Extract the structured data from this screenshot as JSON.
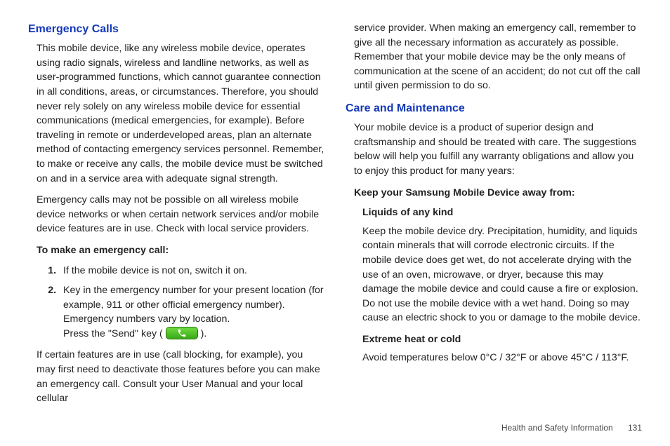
{
  "left": {
    "heading": "Emergency Calls",
    "para1": "This mobile device, like any wireless mobile device, operates using radio signals, wireless and landline networks, as well as user-programmed functions, which cannot guarantee connection in all conditions, areas, or circumstances. Therefore, you should never rely solely on any wireless mobile device for essential communications (medical emergencies, for example). Before traveling in remote or underdeveloped areas, plan an alternate method of contacting emergency services personnel. Remember, to make or receive any calls, the mobile device must be switched on and in a service area with adequate signal strength.",
    "para2": "Emergency calls may not be possible on all wireless mobile device networks or when certain network services and/or mobile device features are in use. Check with local service providers.",
    "subhead": "To make an emergency call:",
    "step1": "If the mobile device is not on, switch it on.",
    "step2a": "Key in the emergency number for your present location (for example, 911 or other official emergency number). Emergency numbers vary by location.",
    "step2b_before": "Press the \"Send\" key ( ",
    "step2b_after": " ).",
    "para3": "If certain features are in use (call blocking, for example), you may first need to deactivate those features before you can make an emergency call. Consult your User Manual and your local cellular"
  },
  "right": {
    "cont": "service provider. When making an emergency call, remember to give all the necessary information as accurately as possible. Remember that your mobile device may be the only means of communication at the scene of an accident; do not cut off the call until given permission to do so.",
    "heading": "Care and Maintenance",
    "para1": "Your mobile device is a product of superior design and craftsmanship and should be treated with care. The suggestions below will help you fulfill any warranty obligations and allow you to enjoy this product for many years:",
    "subhead": "Keep your Samsung Mobile Device away from:",
    "liquids_title": "Liquids of any kind",
    "liquids_body": "Keep the mobile device dry. Precipitation, humidity, and liquids contain minerals that will corrode electronic circuits. If the mobile device does get wet, do not accelerate drying with the use of an oven, microwave, or dryer, because this may damage the mobile device and could cause a fire or explosion. Do not use the mobile device with a wet hand. Doing so may cause an electric shock to you or damage to the mobile device.",
    "heat_title": "Extreme heat or cold",
    "heat_body": "Avoid temperatures below 0°C / 32°F or above 45°C / 113°F."
  },
  "footer": {
    "label": "Health and Safety Information",
    "page": "131"
  }
}
